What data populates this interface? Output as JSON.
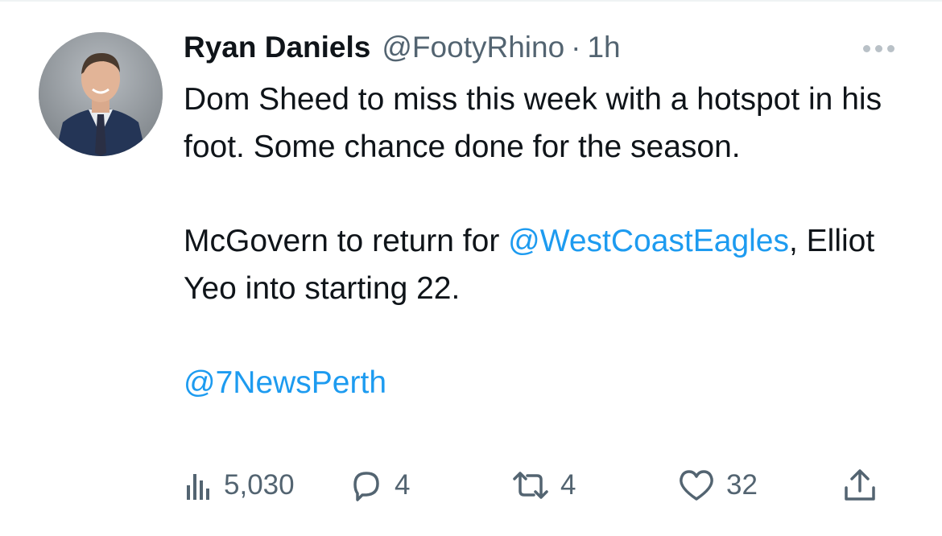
{
  "tweet": {
    "author": {
      "name": "Ryan Daniels",
      "handle": "@FootyRhino",
      "separator": "·",
      "time": "1h"
    },
    "text": {
      "line1": "Dom Sheed to miss this week with a hotspot in his foot. Some chance done for the season.",
      "line2_before": "McGovern to return for ",
      "line2_mention": "@WestCoastEagles",
      "line2_after": ", Elliot Yeo into starting 22.",
      "line3_mention": "@7NewsPerth"
    },
    "stats": {
      "views": "5,030",
      "replies": "4",
      "retweets": "4",
      "likes": "32"
    }
  },
  "icons": {
    "views": "analytics-icon",
    "reply": "reply-icon",
    "retweet": "retweet-icon",
    "like": "heart-icon",
    "share": "share-icon",
    "more": "more-icon"
  },
  "colors": {
    "link": "#1d9bf0",
    "secondary": "#536471",
    "text": "#0f1419"
  }
}
